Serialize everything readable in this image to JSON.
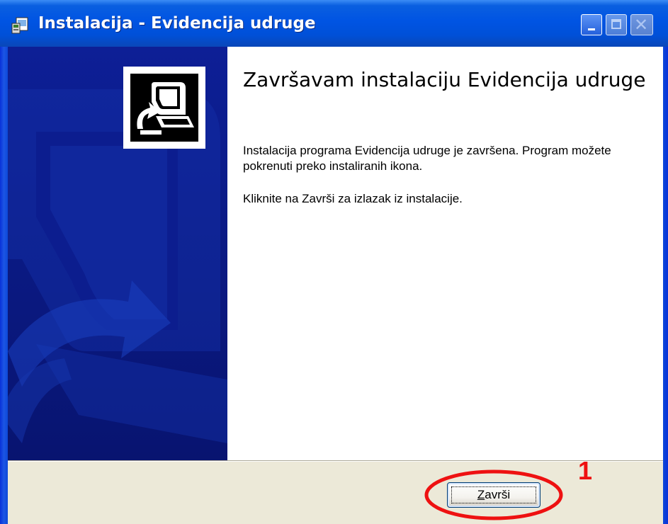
{
  "window": {
    "title": "Instalacija - Evidencija udruge",
    "controls": [
      "minimize-icon",
      "maximize-icon",
      "close-icon"
    ]
  },
  "wizard": {
    "heading": "Završavam instalaciju Evidencija udruge",
    "paragraph1": "Instalacija programa Evidencija udruge je završena. Program možete pokrenuti preko instaliranih ikona.",
    "paragraph2": "Kliknite na Završi za izlazak iz instalacije."
  },
  "buttons": {
    "finish": {
      "label_accel": "Z",
      "label_rest": "avrši"
    }
  },
  "annotation": {
    "number": "1",
    "color": "#ee1111"
  },
  "colors": {
    "titlebar": "#0054e3",
    "banner": "#0a1a86",
    "panel": "#ece9d8"
  }
}
